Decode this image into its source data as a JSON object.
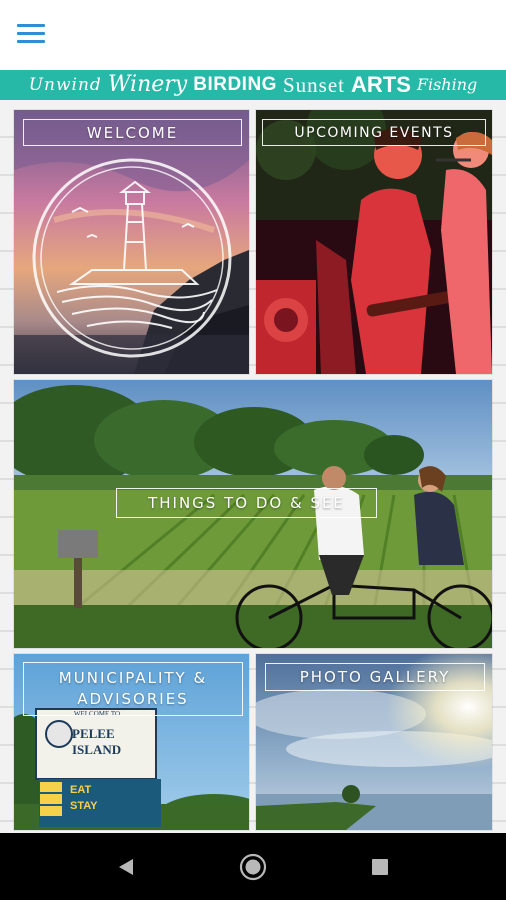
{
  "app": {
    "menu_icon": "hamburger-menu-icon",
    "accent_color": "#2f8fd0"
  },
  "banner": {
    "color": "#27b9a8",
    "words": [
      "Unwind",
      "Winery",
      "BIRDING",
      "Sunset",
      "ARTS",
      "Fishing"
    ]
  },
  "tiles": {
    "welcome": {
      "label": "WELCOME",
      "icon": "lighthouse-logo-icon"
    },
    "events": {
      "label": "UPCOMING EVENTS"
    },
    "things": {
      "label": "THINGS TO DO & SEE"
    },
    "municipality": {
      "label_line1": "MUNICIPALITY &",
      "label_line2": "ADVISORIES",
      "sign_title": "PELEE ISLAND",
      "sign_top": "WELCOME TO",
      "sign_lines": [
        "EAT",
        "STAY"
      ]
    },
    "photo": {
      "label": "PHOTO GALLERY"
    }
  },
  "system_nav": {
    "back_icon": "back-triangle-icon",
    "home_icon": "home-circle-icon",
    "recents_icon": "recents-square-icon"
  }
}
